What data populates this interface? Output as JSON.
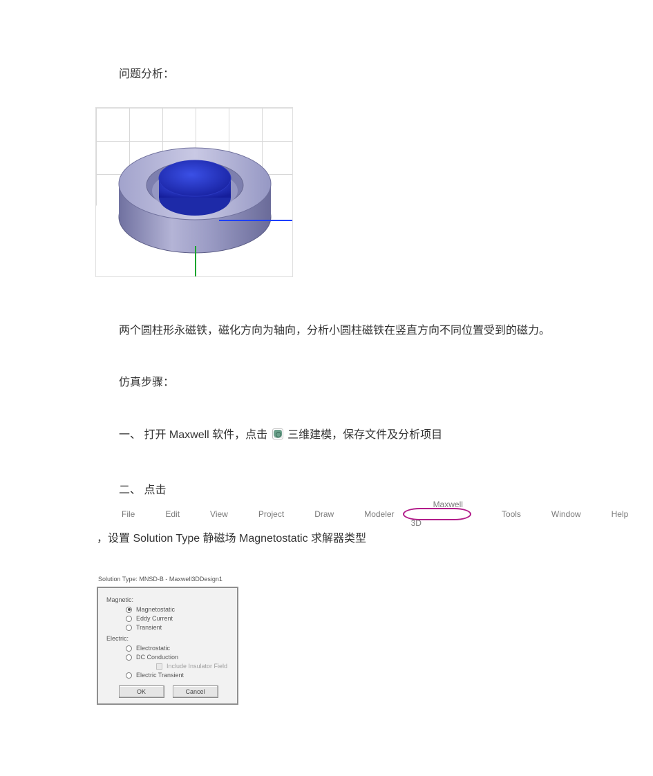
{
  "heading_analysis": "问题分析：",
  "desc_1": "两个圆柱形永磁铁，磁化方向为轴向，分析小圆柱磁铁在竖直方向不同位置受到的磁力。",
  "heading_steps": "仿真步骤：",
  "step1": {
    "num": "一、",
    "before_icon": "打开 Maxwell 软件，点击",
    "after_icon": "三维建模，保存文件及分析项目"
  },
  "step2": {
    "num": "二、",
    "before_menu": "点击",
    "after_menu": "，设置 Solution Type 静磁场 Magnetostatic 求解器类型"
  },
  "menu": {
    "items": [
      "File",
      "Edit",
      "View",
      "Project",
      "Draw",
      "Modeler"
    ],
    "highlighted": "Maxwell 3D",
    "items_after": [
      "Tools",
      "Window",
      "Help"
    ]
  },
  "dialog": {
    "title": "Solution Type: MNSD-B - Maxwell3DDesign1",
    "group_magnetic": "Magnetic:",
    "opt_magnetostatic": "Magnetostatic",
    "opt_eddy": "Eddy Current",
    "opt_transient": "Transient",
    "group_electric": "Electric:",
    "opt_electrostatic": "Electrostatic",
    "opt_dc": "DC Conduction",
    "chk_insulator": "Include Insulator Field",
    "opt_elec_transient": "Electric Transient",
    "btn_ok": "OK",
    "btn_cancel": "Cancel"
  }
}
